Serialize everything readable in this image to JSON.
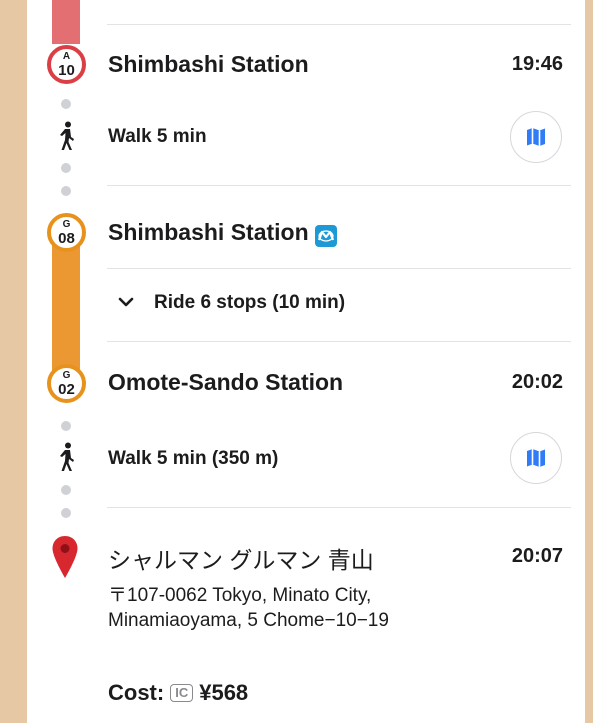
{
  "colors": {
    "line_red": "#e46f73",
    "line_orange": "#eb9832",
    "badge_red": "#d93f44",
    "badge_orange": "#e8921e",
    "map_blue": "#2f7cf6",
    "metro_blue": "#1d9ad6",
    "pin_red": "#d7282f"
  },
  "steps": [
    {
      "badge_letter": "A",
      "badge_number": "10",
      "title": "Shimbashi Station",
      "time": "19:46"
    },
    {
      "walk_label": "Walk 5 min",
      "icon": "walking-person-icon",
      "map_icon": "map-icon"
    },
    {
      "badge_letter": "G",
      "badge_number": "08",
      "title": "Shimbashi Station",
      "line_icon": "tokyo-metro-icon"
    },
    {
      "ride_label": "Ride 6 stops (10 min)",
      "icon": "chevron-down-icon"
    },
    {
      "badge_letter": "G",
      "badge_number": "02",
      "title": "Omote-Sando Station",
      "time": "20:02"
    },
    {
      "walk_label": "Walk 5 min (350 m)",
      "icon": "walking-person-icon",
      "map_icon": "map-icon"
    },
    {
      "title": "シャルマン グルマン 青山",
      "time": "20:07",
      "address_line1": "〒107-0062 Tokyo, Minato City,",
      "address_line2": "Minamiaoyama, 5 Chome−10−19",
      "icon": "location-pin-icon"
    }
  ],
  "cost": {
    "label": "Cost:",
    "ic_label": "IC",
    "amount": "¥568"
  }
}
